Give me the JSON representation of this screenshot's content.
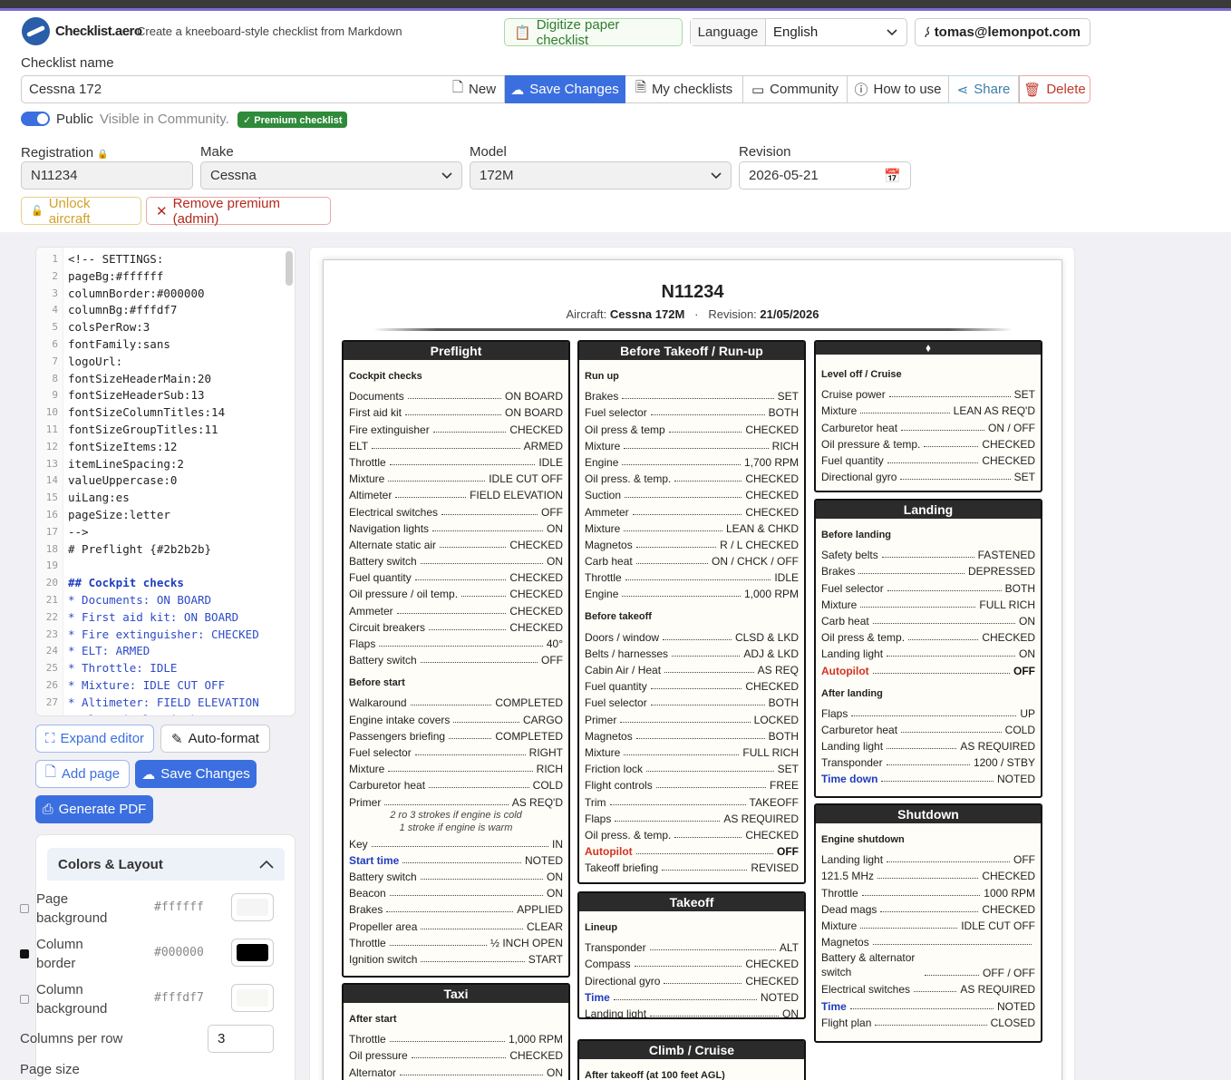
{
  "brand": {
    "name": "Checklist.aero",
    "tagline": "Create a kneeboard-style checklist from Markdown"
  },
  "topnav": {
    "digitize": "Digitize paper checklist",
    "language_label": "Language",
    "language_value": "English",
    "user": "tomas@lemonpot.com"
  },
  "form": {
    "name_label": "Checklist name",
    "name_value": "Cessna 172",
    "toolbar": {
      "new": "New",
      "save": "Save Changes",
      "my": "My checklists",
      "community": "Community",
      "how": "How to use",
      "share": "Share",
      "delete": "Delete"
    },
    "public_label": "Public",
    "public_hint": "Visible in Community.",
    "premium_badge": "✓ Premium checklist",
    "registration_label": "Registration",
    "registration_value": "N11234",
    "make_label": "Make",
    "make_value": "Cessna",
    "model_label": "Model",
    "model_value": "172M",
    "revision_label": "Revision",
    "revision_value": "2026-05-21",
    "unlock": "Unlock aircraft",
    "remove_premium": "Remove premium (admin)"
  },
  "editor": {
    "lines": [
      "<!-- SETTINGS:",
      "pageBg:#ffffff",
      "columnBorder:#000000",
      "columnBg:#fffdf7",
      "colsPerRow:3",
      "fontFamily:sans",
      "logoUrl:",
      "fontSizeHeaderMain:20",
      "fontSizeHeaderSub:13",
      "fontSizeColumnTitles:14",
      "fontSizeGroupTitles:11",
      "fontSizeItems:12",
      "itemLineSpacing:2",
      "valueUppercase:0",
      "uiLang:es",
      "pageSize:letter",
      "-->",
      "# Preflight {#2b2b2b}",
      "",
      "## Cockpit checks",
      "* Documents: ON BOARD",
      "* First aid kit: ON BOARD",
      "* Fire extinguisher: CHECKED",
      "* ELT: ARMED",
      "* Throttle: IDLE",
      "* Mixture: IDLE CUT OFF",
      "* Altimeter: FIELD ELEVATION",
      "* Electrical switches: OFF"
    ]
  },
  "side": {
    "expand": "Expand editor",
    "autoformat": "Auto-format",
    "addpage": "Add page",
    "save": "Save Changes",
    "pdf": "Generate PDF"
  },
  "colors_panel": {
    "title": "Colors & Layout",
    "page_bg_label1": "Page",
    "page_bg_label2": "background",
    "page_bg_value": "#ffffff",
    "border_label1": "Column",
    "border_label2": "border",
    "border_value": "#000000",
    "col_bg_label1": "Column",
    "col_bg_label2": "background",
    "col_bg_value": "#fffdf7",
    "cols_label": "Columns per row",
    "cols_value": "3",
    "pagesize_label": "Page size"
  },
  "doc": {
    "title": "N11234",
    "aircraft_label": "Aircraft:",
    "aircraft": "Cessna 172M",
    "sep": "·",
    "revision_label": "Revision:",
    "revision": "21/05/2026"
  },
  "columns": [
    {
      "title": "Preflight",
      "groups": [
        {
          "name": "Cockpit checks",
          "items": [
            [
              "Documents",
              "ON BOARD"
            ],
            [
              "First aid kit",
              "ON BOARD"
            ],
            [
              "Fire extinguisher",
              "CHECKED"
            ],
            [
              "ELT",
              "ARMED"
            ],
            [
              "Throttle",
              "IDLE"
            ],
            [
              "Mixture",
              "IDLE CUT OFF"
            ],
            [
              "Altimeter",
              "FIELD ELEVATION"
            ],
            [
              "Electrical switches",
              "OFF"
            ],
            [
              "Navigation lights",
              "ON"
            ],
            [
              "Alternate static air",
              "CHECKED"
            ],
            [
              "Battery switch",
              "ON"
            ],
            [
              "Fuel quantity",
              "CHECKED"
            ],
            [
              "Oil pressure / oil temp.",
              "CHECKED"
            ],
            [
              "Ammeter",
              "CHECKED"
            ],
            [
              "Circuit breakers",
              "CHECKED"
            ],
            [
              "Flaps",
              "40°"
            ],
            [
              "Battery switch",
              "OFF"
            ]
          ]
        },
        {
          "name": "Before start",
          "items": [
            [
              "Walkaround",
              "COMPLETED"
            ],
            [
              "Engine intake covers",
              "CARGO"
            ],
            [
              "Passengers briefing",
              "COMPLETED"
            ],
            [
              "Fuel selector",
              "RIGHT"
            ],
            [
              "Mixture",
              "RICH"
            ],
            [
              "Carburetor heat",
              "COLD"
            ],
            [
              "Primer",
              "AS REQ'D"
            ]
          ],
          "note": [
            "2 ro 3 strokes if engine is cold",
            "1 stroke if engine is warm"
          ],
          "items2": [
            [
              "Key",
              "IN",
              ""
            ],
            [
              "Start time",
              "NOTED",
              "blue"
            ],
            [
              "Battery switch",
              "ON",
              ""
            ],
            [
              "Beacon",
              "ON",
              ""
            ],
            [
              "Brakes",
              "APPLIED",
              ""
            ],
            [
              "Propeller area",
              "CLEAR",
              ""
            ],
            [
              "Throttle",
              "½ INCH OPEN",
              ""
            ],
            [
              "Ignition switch",
              "START",
              ""
            ]
          ]
        }
      ]
    },
    {
      "title": "Taxi",
      "groups": [
        {
          "name": "After start",
          "items": [
            [
              "Throttle",
              "1,000 RPM"
            ],
            [
              "Oil pressure",
              "CHECKED"
            ],
            [
              "Alternator",
              "ON"
            ]
          ]
        }
      ]
    },
    {
      "title": "Before Takeoff / Run-up",
      "groups": [
        {
          "name": "Run up",
          "items": [
            [
              "Brakes",
              "SET"
            ],
            [
              "Fuel selector",
              "BOTH"
            ],
            [
              "Oil press & temp",
              "CHECKED"
            ],
            [
              "Mixture",
              "RICH"
            ],
            [
              "Engine",
              "1,700 RPM"
            ],
            [
              "Oil press. & temp.",
              "CHECKED"
            ],
            [
              "Suction",
              "CHECKED"
            ],
            [
              "Ammeter",
              "CHECKED"
            ],
            [
              "Mixture",
              "LEAN & CHKD"
            ],
            [
              "Magnetos",
              "R / L CHECKED"
            ],
            [
              "Carb heat",
              "ON / CHCK / OFF"
            ],
            [
              "Throttle",
              "IDLE"
            ],
            [
              "Engine",
              "1,000 RPM"
            ]
          ]
        },
        {
          "name": "Before takeoff",
          "items": [
            [
              "Doors / window",
              "CLSD & LKD"
            ],
            [
              "Belts / harnesses",
              "ADJ & LKD"
            ],
            [
              "Cabin Air / Heat",
              "AS REQ"
            ],
            [
              "Fuel quantity",
              "CHECKED"
            ],
            [
              "Fuel selector",
              "BOTH"
            ],
            [
              "Primer",
              "LOCKED"
            ],
            [
              "Magnetos",
              "BOTH"
            ],
            [
              "Mixture",
              "FULL RICH"
            ],
            [
              "Friction lock",
              "SET"
            ],
            [
              "Flight controls",
              "FREE"
            ],
            [
              "Trim",
              "TAKEOFF"
            ],
            [
              "Flaps",
              "AS REQUIRED"
            ],
            [
              "Oil press. & temp.",
              "CHECKED"
            ],
            [
              "Autopilot",
              "OFF",
              "red"
            ],
            [
              "Takeoff briefing",
              "REVISED"
            ]
          ]
        }
      ]
    },
    {
      "title": "Takeoff",
      "groups": [
        {
          "name": "Lineup",
          "items": [
            [
              "Transponder",
              "ALT"
            ],
            [
              "Compass",
              "CHECKED"
            ],
            [
              "Directional gyro",
              "CHECKED"
            ],
            [
              "Time",
              "NOTED",
              "blue"
            ],
            [
              "Landing light",
              "ON"
            ]
          ]
        }
      ]
    },
    {
      "title": "Climb / Cruise",
      "groups": [
        {
          "name": "After takeoff (at 100 feet AGL)",
          "items": []
        }
      ]
    },
    {
      "title": "⬧",
      "groups": [
        {
          "name": "Level off / Cruise",
          "items": [
            [
              "Cruise power",
              "SET"
            ],
            [
              "Mixture",
              "LEAN AS REQ'D"
            ],
            [
              "Carburetor heat",
              "ON / OFF"
            ],
            [
              "Oil pressure & temp.",
              "CHECKED"
            ],
            [
              "Fuel quantity",
              "CHECKED"
            ],
            [
              "Directional gyro",
              "SET"
            ]
          ]
        }
      ]
    },
    {
      "title": "Landing",
      "groups": [
        {
          "name": "Before landing",
          "items": [
            [
              "Safety belts",
              "FASTENED"
            ],
            [
              "Brakes",
              "DEPRESSED"
            ],
            [
              "Fuel selector",
              "BOTH"
            ],
            [
              "Mixture",
              "FULL RICH"
            ],
            [
              "Carb heat",
              "ON"
            ],
            [
              "Oil press & temp.",
              "CHECKED"
            ],
            [
              "Landing light",
              "ON"
            ],
            [
              "Autopilot",
              "OFF",
              "red"
            ]
          ]
        },
        {
          "name": "After landing",
          "items": [
            [
              "Flaps",
              "UP"
            ],
            [
              "Carburetor heat",
              "COLD"
            ],
            [
              "Landing light",
              "AS REQUIRED"
            ],
            [
              "Transponder",
              "1200 / STBY"
            ],
            [
              "Time down",
              "NOTED",
              "blue"
            ]
          ]
        }
      ]
    },
    {
      "title": "Shutdown",
      "groups": [
        {
          "name": "Engine shutdown",
          "items": [
            [
              "Landing light",
              "OFF"
            ],
            [
              "121.5 MHz",
              "CHECKED"
            ],
            [
              "Throttle",
              "1000 RPM"
            ],
            [
              "Dead mags",
              "CHECKED"
            ],
            [
              "Mixture",
              "IDLE CUT OFF"
            ],
            [
              "Magnetos",
              ""
            ],
            [
              "Battery & alternator switch",
              "OFF / OFF"
            ],
            [
              "Electrical switches",
              "AS REQUIRED"
            ],
            [
              "Time",
              "NOTED",
              "blue"
            ],
            [
              "Flight plan",
              "CLOSED"
            ]
          ]
        }
      ]
    }
  ]
}
